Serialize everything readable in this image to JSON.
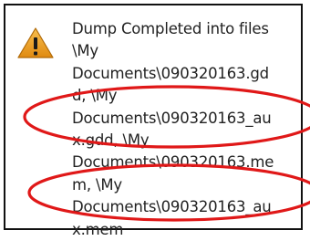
{
  "dialog": {
    "icon": "warning-icon",
    "message_lines": [
      "Dump Completed into files",
      "\\My",
      "Documents\\090320163.gd",
      "d, \\My",
      "Documents\\090320163_au",
      "x.gdd, \\My",
      "Documents\\090320163.me",
      "m, \\My",
      "Documents\\090320163_au",
      "x.mem"
    ]
  },
  "colors": {
    "warning_fill": "#F0A020",
    "annotation": "#E01818",
    "frame": "#111111",
    "text": "#222222"
  }
}
